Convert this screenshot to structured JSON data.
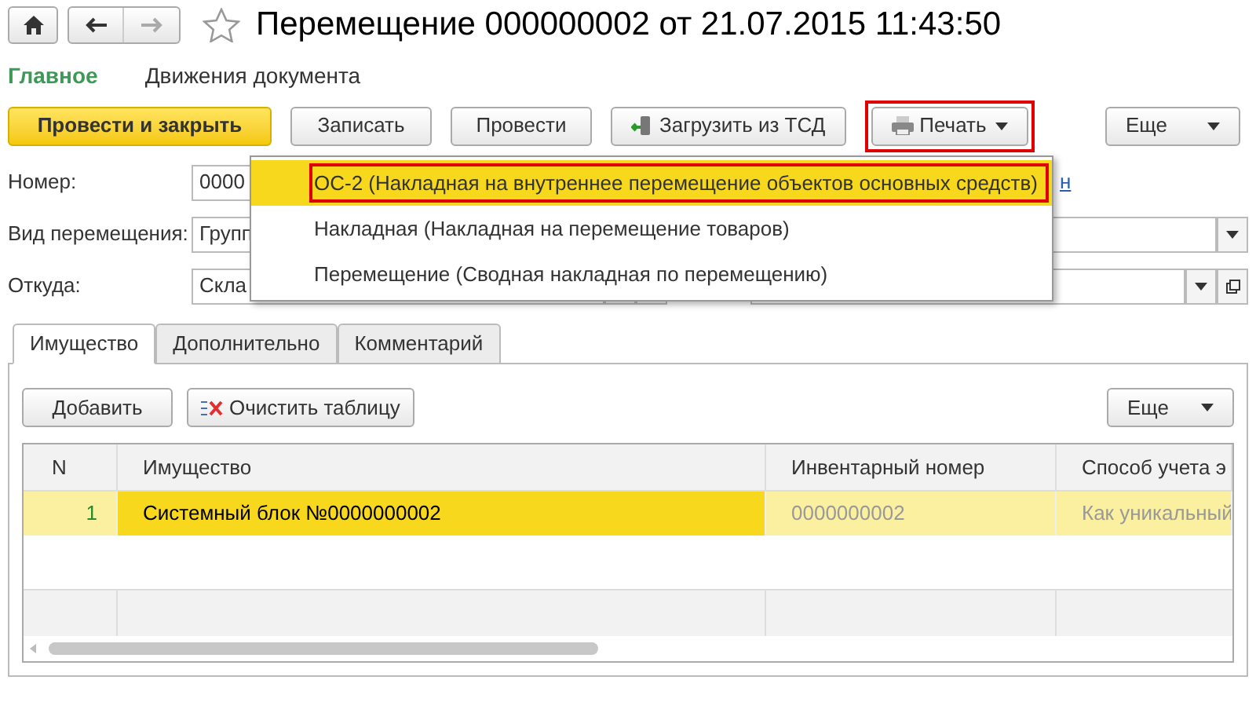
{
  "window": {
    "title": "Перемещение 000000002 от 21.07.2015 11:43:50",
    "favorite": false
  },
  "sections": [
    {
      "label": "Главное",
      "selected": true
    },
    {
      "label": "Движения документа",
      "selected": false
    }
  ],
  "toolbar": [
    {
      "kind": "primary",
      "label": "Провести и закрыть"
    },
    {
      "kind": "plain",
      "label": "Записать"
    },
    {
      "kind": "plain",
      "label": "Провести"
    },
    {
      "kind": "import",
      "label": "Загрузить из ТСД"
    },
    {
      "kind": "print",
      "label": "Печать",
      "highlighted": true
    }
  ],
  "toolbar_more": {
    "label": "Еще"
  },
  "fields": {
    "number": {
      "label": "Номер:",
      "value": "0000",
      "link": "н"
    },
    "movement_type": {
      "label": "Вид перемещения:",
      "value": "Групп"
    },
    "from": {
      "label": "Откуда:",
      "value": "Скла"
    }
  },
  "print_menu": [
    {
      "label": "ОС-2 (Накладная на внутреннее перемещение объектов основных средств)",
      "selected": true
    },
    {
      "label": "Накладная (Накладная на перемещение товаров)",
      "selected": false
    },
    {
      "label": "Перемещение (Сводная накладная по перемещению)",
      "selected": false
    }
  ],
  "tabs": [
    {
      "label": "Имущество",
      "selected": true
    },
    {
      "label": "Дополнительно",
      "selected": false
    },
    {
      "label": "Комментарий",
      "selected": false
    }
  ],
  "table_toolbar": {
    "add": "Добавить",
    "clear": "Очистить таблицу",
    "more": "Еще"
  },
  "table": {
    "columns": [
      "N",
      "Имущество",
      "Инвентарный номер",
      "Способ учета э"
    ],
    "rows": [
      {
        "cells": [
          "1",
          "Системный блок №0000000002",
          "0000000002",
          "Как уникальный"
        ],
        "selected": true
      }
    ]
  }
}
